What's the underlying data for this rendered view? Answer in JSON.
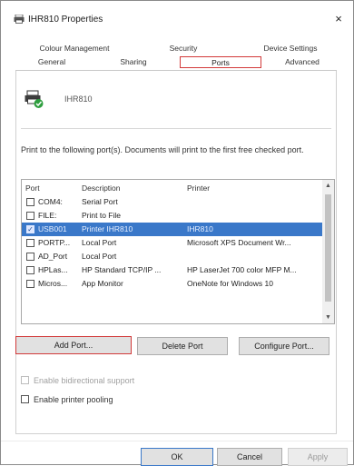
{
  "window": {
    "title": "IHR810 Properties",
    "close_glyph": "×"
  },
  "tabs": {
    "row1": [
      "Colour Management",
      "Security",
      "Device Settings"
    ],
    "row2": [
      "General",
      "Sharing",
      "Ports",
      "Advanced"
    ],
    "selected": "Ports"
  },
  "printer": {
    "name": "IHR810",
    "icon": "printer-check-icon"
  },
  "instructions": "Print to the following port(s). Documents will print to the first free checked port.",
  "port_list": {
    "columns": [
      "Port",
      "Description",
      "Printer"
    ],
    "rows": [
      {
        "checked": false,
        "port": "COM4:",
        "description": "Serial Port",
        "printer": ""
      },
      {
        "checked": false,
        "port": "FILE:",
        "description": "Print to File",
        "printer": ""
      },
      {
        "checked": true,
        "port": "USB001",
        "description": "Printer IHR810",
        "printer": "IHR810",
        "selected": true
      },
      {
        "checked": false,
        "port": "PORTP...",
        "description": "Local Port",
        "printer": "Microsoft XPS Document Wr..."
      },
      {
        "checked": false,
        "port": "AD_Port",
        "description": "Local Port",
        "printer": ""
      },
      {
        "checked": false,
        "port": "HPLas...",
        "description": "HP Standard TCP/IP ...",
        "printer": "HP LaserJet 700 color MFP M..."
      },
      {
        "checked": false,
        "port": "Micros...",
        "description": "App Monitor",
        "printer": "OneNote for Windows 10"
      }
    ]
  },
  "buttons": {
    "add_port": "Add Port...",
    "delete_port": "Delete Port",
    "configure_port": "Configure Port...",
    "ok": "OK",
    "cancel": "Cancel",
    "apply": "Apply"
  },
  "options": {
    "bidirectional": "Enable bidirectional support",
    "pooling": "Enable printer pooling"
  },
  "colors": {
    "selection": "#3a78c9",
    "highlight_outline": "#d23a3a"
  }
}
